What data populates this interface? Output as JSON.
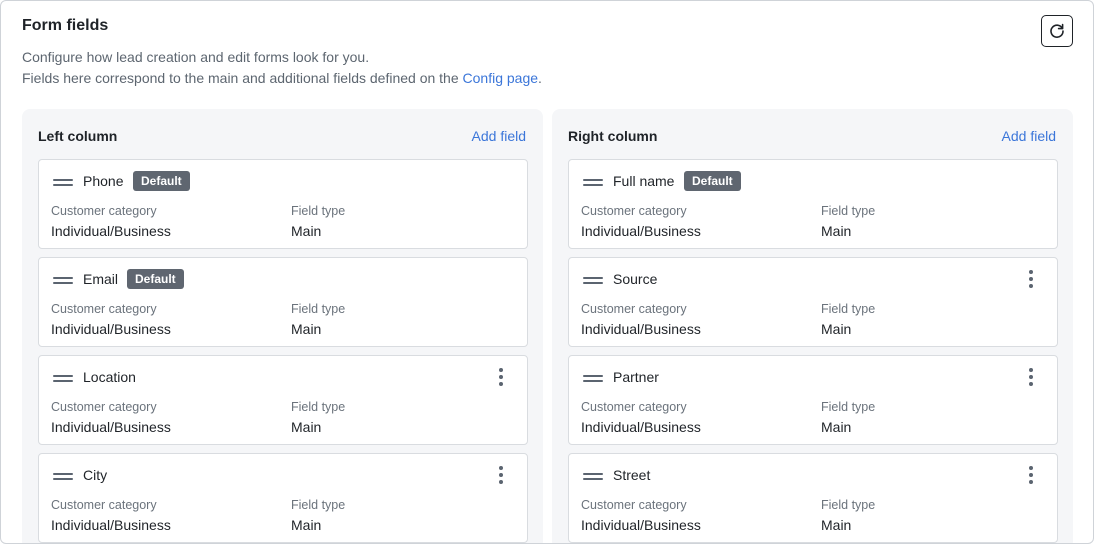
{
  "header": {
    "title": "Form fields",
    "desc_line1": "Configure how lead creation and edit forms look for you.",
    "desc_line2_prefix": "Fields here correspond to the main and additional fields defined on the ",
    "desc_line2_link": "Config page",
    "desc_line2_suffix": "."
  },
  "labels": {
    "category": "Customer category",
    "type": "Field type"
  },
  "left": {
    "title": "Left column",
    "add_label": "Add field",
    "fields": [
      {
        "name": "Phone",
        "badge": "Default",
        "category": "Individual/Business",
        "type": "Main"
      },
      {
        "name": "Email",
        "badge": "Default",
        "category": "Individual/Business",
        "type": "Main"
      },
      {
        "name": "Location",
        "category": "Individual/Business",
        "type": "Main"
      },
      {
        "name": "City",
        "category": "Individual/Business",
        "type": "Main"
      }
    ]
  },
  "right": {
    "title": "Right column",
    "add_label": "Add field",
    "fields": [
      {
        "name": "Full name",
        "badge": "Default",
        "category": "Individual/Business",
        "type": "Main"
      },
      {
        "name": "Source",
        "category": "Individual/Business",
        "type": "Main"
      },
      {
        "name": "Partner",
        "category": "Individual/Business",
        "type": "Main"
      },
      {
        "name": "Street",
        "category": "Individual/Business",
        "type": "Main"
      }
    ]
  }
}
